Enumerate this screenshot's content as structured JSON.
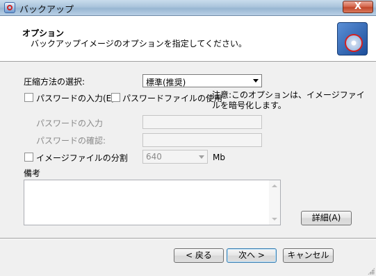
{
  "window": {
    "title": "バックアップ",
    "close_label": "X"
  },
  "header": {
    "title": "オプション",
    "subtitle": "バックアップイメージのオプションを指定してください。"
  },
  "compression": {
    "label": "圧縮方法の選択:",
    "selected": "標準(推奨)"
  },
  "password": {
    "checkbox_label": "パスワードの入力(E)",
    "file_checkbox_label": "パスワードファイルの使用",
    "note": [
      "注意:このオプションは、イメージファイ",
      "ルを暗号化します。"
    ],
    "input_label": "パスワードの入力",
    "confirm_label": "パスワードの確認:"
  },
  "split": {
    "checkbox_label": "イメージファイルの分割",
    "value": "640",
    "unit": "Mb"
  },
  "memo": {
    "label": "備考"
  },
  "buttons": {
    "details": "詳細(A)",
    "back": "< 戻る",
    "next": "次へ >",
    "cancel": "キャンセル"
  }
}
